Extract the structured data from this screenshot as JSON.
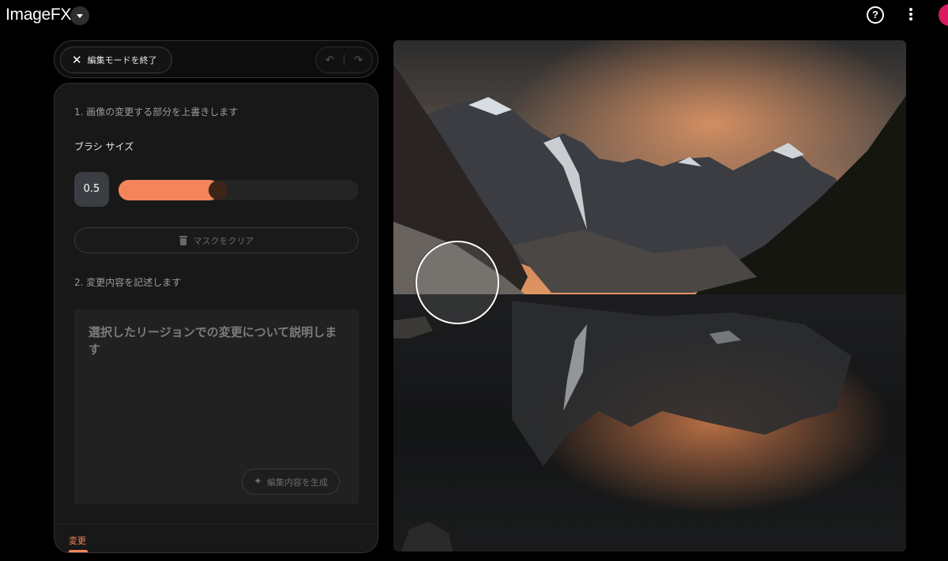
{
  "app": {
    "title": "ImageFX"
  },
  "header": {
    "help_icon": "help-circle-icon",
    "menu_icon": "more-vert-icon",
    "help_glyph": "?"
  },
  "toolbar": {
    "exit_label": "編集モードを終了",
    "exit_icon": "close-icon",
    "undo_icon": "undo-icon",
    "redo_icon": "redo-icon"
  },
  "panel": {
    "step1_label": "1. 画像の変更する部分を上書きします",
    "brush_size_label": "ブラシ サイズ",
    "brush_size_value": "0.5",
    "brush_size_fraction": 0.42,
    "clear_mask_label": "マスクをクリア",
    "step2_label": "2. 変更内容を記述します",
    "prompt_placeholder": "選択したリージョンでの変更について説明します",
    "generate_label": "編集内容を生成",
    "tab_label": "変更"
  },
  "colors": {
    "accent": "#f4855b",
    "background": "#000000",
    "panel": "#181818",
    "avatar": "#d81b60"
  }
}
